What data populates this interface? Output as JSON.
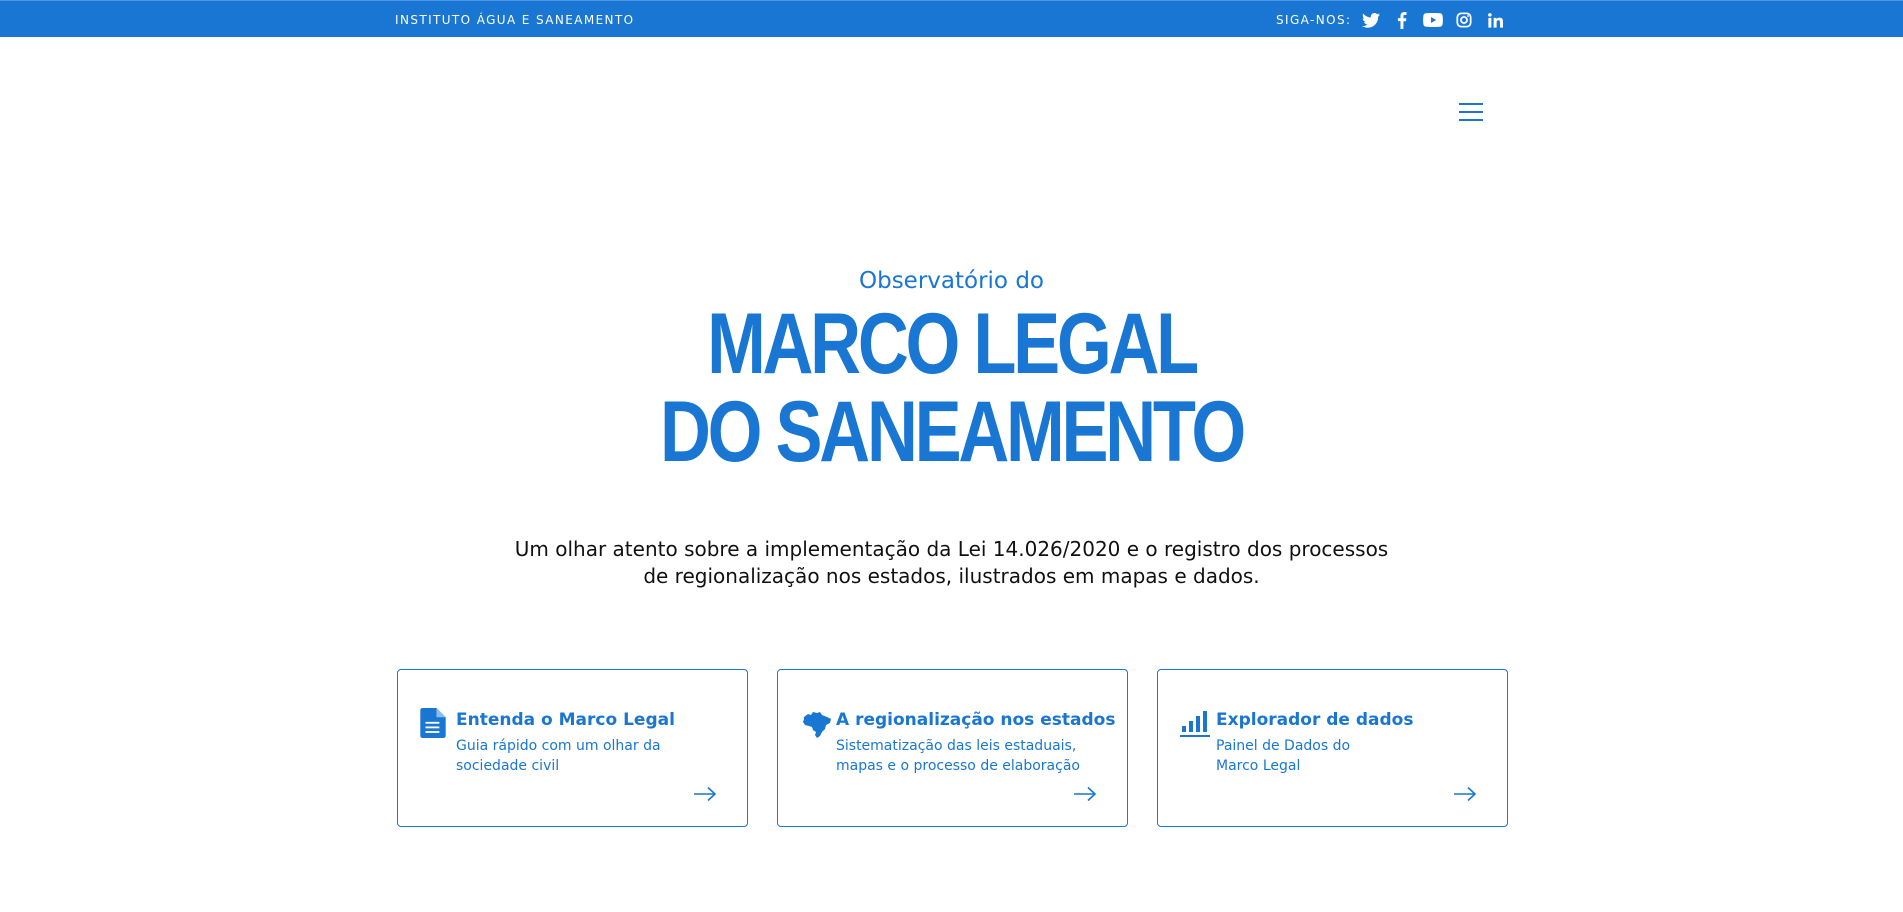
{
  "topbar": {
    "org_name": "INSTITUTO ÁGUA E SANEAMENTO",
    "follow_label": "SIGA-NOS:",
    "social": [
      "twitter-icon",
      "facebook-icon",
      "youtube-icon",
      "instagram-icon",
      "linkedin-icon"
    ],
    "background": "#1976d2"
  },
  "header": {
    "menu_icon": "hamburger-menu-icon"
  },
  "hero": {
    "pretitle": "Observatório do",
    "title_line1": "MARCO LEGAL",
    "title_line2": "DO SANEAMENTO",
    "description_line1": "Um olhar atento sobre a implementação da Lei 14.026/2020 e o registro dos processos",
    "description_line2": "de regionalização nos estados, ilustrados em mapas e dados."
  },
  "cards": [
    {
      "icon": "document-icon",
      "title": "Entenda o Marco Legal",
      "desc_line1": "Guia rápido com um olhar da",
      "desc_line2": "sociedade civil"
    },
    {
      "icon": "brazil-map-icon",
      "title": "A regionalização nos estados",
      "desc_line1": "Sistematização das leis estaduais,",
      "desc_line2": "mapas e o processo de elaboração"
    },
    {
      "icon": "bar-chart-icon",
      "title": "Explorador de dados",
      "desc_line1": "Painel de Dados do",
      "desc_line2": "Marco Legal"
    }
  ],
  "colors": {
    "accent": "#1976d2",
    "text": "#111111"
  }
}
